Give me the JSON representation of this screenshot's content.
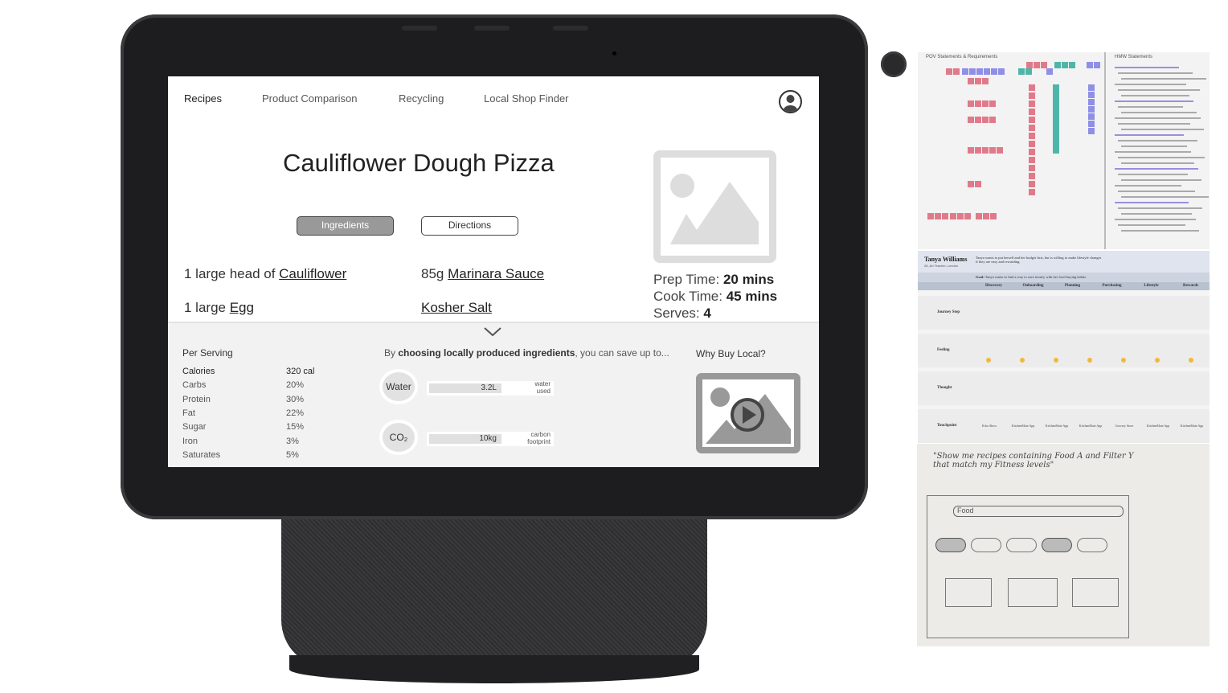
{
  "nav": {
    "items": [
      "Recipes",
      "Product Comparison",
      "Recycling",
      "Local Shop Finder"
    ],
    "active": "Recipes",
    "profile_icon": "user-circle-icon"
  },
  "recipe": {
    "title": "Cauliflower Dough Pizza",
    "tabs": {
      "ingredients": "Ingredients",
      "directions": "Directions",
      "active": "Ingredients"
    },
    "ingredients": [
      {
        "qty": "1 large head of",
        "name": "Cauliflower"
      },
      {
        "qty": "85g",
        "name": "Marinara Sauce"
      },
      {
        "qty": "1 large",
        "name": "Egg"
      },
      {
        "qty": "",
        "name": "Kosher Salt"
      }
    ],
    "prep_label": "Prep Time:",
    "prep_value": "20 mins",
    "cook_label": "Cook Time:",
    "cook_value": "45 mins",
    "serves_label": "Serves:",
    "serves_value": "4"
  },
  "nutrition": {
    "heading": "Per Serving",
    "rows": [
      {
        "label": "Calories",
        "value": "320 cal"
      },
      {
        "label": "Carbs",
        "value": "20%"
      },
      {
        "label": "Protein",
        "value": "30%"
      },
      {
        "label": "Fat",
        "value": "22%"
      },
      {
        "label": "Sugar",
        "value": "15%"
      },
      {
        "label": "Iron",
        "value": "3%"
      },
      {
        "label": "Saturates",
        "value": "5%"
      }
    ]
  },
  "local": {
    "intro_pre": "By ",
    "intro_bold": "choosing locally produced ingredients",
    "intro_post": ", you can save up to...",
    "savings": [
      {
        "label": "Water",
        "value": "3.2L",
        "caption1": "water",
        "caption2": "used"
      },
      {
        "label": "CO₂",
        "value": "10kg",
        "caption1": "carbon",
        "caption2": "footprint"
      }
    ],
    "why_title": "Why Buy Local?"
  },
  "boards": {
    "pov_title": "POV Statements & Requirements",
    "hmw_title": "HMW Statements",
    "persona_name": "Tanya Williams",
    "persona_sub": "28, Art Teacher, London",
    "persona_quote": "Tanya wants to put herself and her budget first, but is willing to make lifestyle changes if they are easy and rewarding.",
    "goal_label": "Goal:",
    "goal_text": "Tanya wants to find a way to save money with her food buying habits.",
    "stages": [
      "Discovery",
      "Onboarding",
      "Planning",
      "Purchasing",
      "Lifestyle",
      "Rewards"
    ],
    "rows": [
      "Journey Step",
      "Feeling",
      "Thought",
      "Touchpoint"
    ],
    "touchpoints": [
      "Echo Show",
      "KitchenMate App",
      "KitchenMate App",
      "KitchenMate App",
      "Grocery Store",
      "KitchenMate App",
      "KitchenMate App"
    ],
    "sketch_caption": "\"Show me recipes containing Food A and Filter Y that match my Fitness levels\""
  },
  "colors": {
    "bezel": "#1d1d1f",
    "screen_bg": "#ffffff",
    "panel_bg": "#f2f2f2",
    "active_tab": "#999999"
  }
}
